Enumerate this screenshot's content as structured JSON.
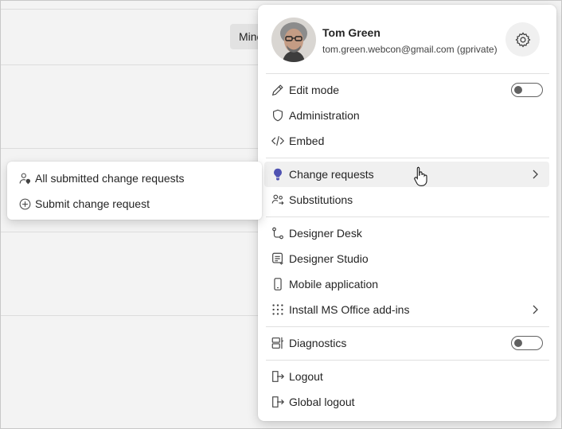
{
  "background": {
    "chip_label": "Mine"
  },
  "profile": {
    "name": "Tom Green",
    "email": "tom.green.webcon@gmail.com (gprivate)"
  },
  "menu": {
    "edit_mode": {
      "label": "Edit mode",
      "toggle_on": false
    },
    "administration": "Administration",
    "embed": "Embed",
    "change_requests": "Change requests",
    "substitutions": "Substitutions",
    "designer_desk": "Designer Desk",
    "designer_studio": "Designer Studio",
    "mobile_application": "Mobile application",
    "install_office": "Install MS Office add-ins",
    "diagnostics": {
      "label": "Diagnostics",
      "toggle_on": false
    },
    "logout": "Logout",
    "global_logout": "Global logout"
  },
  "submenu": {
    "all_submitted": "All submitted change requests",
    "submit": "Submit change request"
  },
  "colors": {
    "accent_bulb": "#4f52b2",
    "toggle_border": "#616161"
  }
}
